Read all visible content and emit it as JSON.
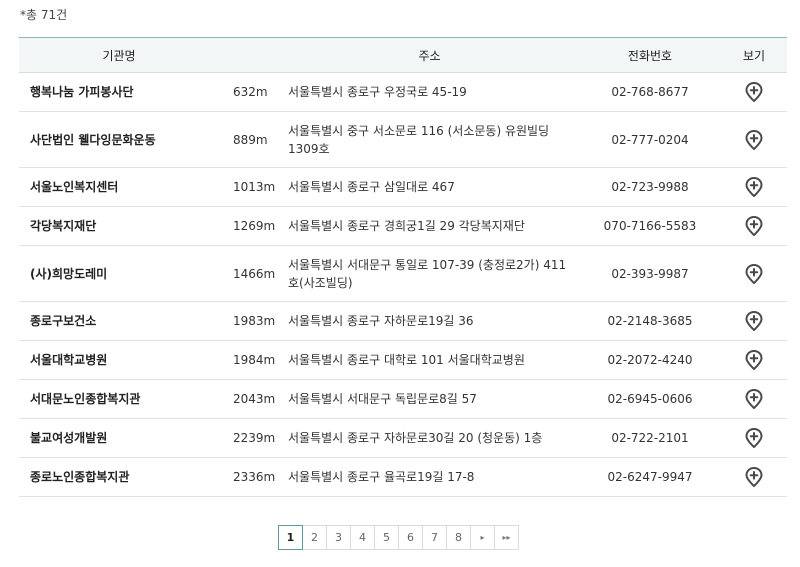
{
  "summary": {
    "total": "*총 71건"
  },
  "table": {
    "headers": {
      "name": "기관명",
      "address": "주소",
      "phone": "전화번호",
      "view": "보기"
    },
    "rows": [
      {
        "name": "행복나눔 가피봉사단",
        "distance": "632m",
        "address": "서울특별시 종로구 우정국로 45-19",
        "phone": "02-768-8677"
      },
      {
        "name": "사단법인 웰다잉문화운동",
        "distance": "889m",
        "address": "서울특별시 중구 서소문로 116 (서소문동) 유원빌딩 1309호",
        "phone": "02-777-0204"
      },
      {
        "name": "서울노인복지센터",
        "distance": "1013m",
        "address": "서울특별시 종로구 삼일대로 467",
        "phone": "02-723-9988"
      },
      {
        "name": "각당복지재단",
        "distance": "1269m",
        "address": "서울특별시 종로구 경희궁1길 29 각당복지재단",
        "phone": "070-7166-5583"
      },
      {
        "name": "(사)희망도레미",
        "distance": "1466m",
        "address": "서울특별시 서대문구 통일로 107-39 (충정로2가) 411호(사조빌딩)",
        "phone": "02-393-9987"
      },
      {
        "name": "종로구보건소",
        "distance": "1983m",
        "address": "서울특별시 종로구 자하문로19길 36",
        "phone": "02-2148-3685"
      },
      {
        "name": "서울대학교병원",
        "distance": "1984m",
        "address": "서울특별시 종로구 대학로 101 서울대학교병원",
        "phone": "02-2072-4240"
      },
      {
        "name": "서대문노인종합복지관",
        "distance": "2043m",
        "address": "서울특별시 서대문구 독립문로8길 57",
        "phone": "02-6945-0606"
      },
      {
        "name": "불교여성개발원",
        "distance": "2239m",
        "address": "서울특별시 종로구 자하문로30길 20 (청운동) 1층",
        "phone": "02-722-2101"
      },
      {
        "name": "종로노인종합복지관",
        "distance": "2336m",
        "address": "서울특별시 종로구 율곡로19길 17-8",
        "phone": "02-6247-9947"
      }
    ]
  },
  "pagination": {
    "pages": [
      "1",
      "2",
      "3",
      "4",
      "5",
      "6",
      "7",
      "8"
    ],
    "current": "1",
    "next_label": "▸",
    "last_label": "▸▸"
  },
  "icons": {
    "view": "map-pin-plus-icon"
  },
  "colors": {
    "header_border": "#8fb8bd",
    "header_bg": "#f3f6f6",
    "pin": "#4a4a4a",
    "active_page": "#5e98a0"
  }
}
